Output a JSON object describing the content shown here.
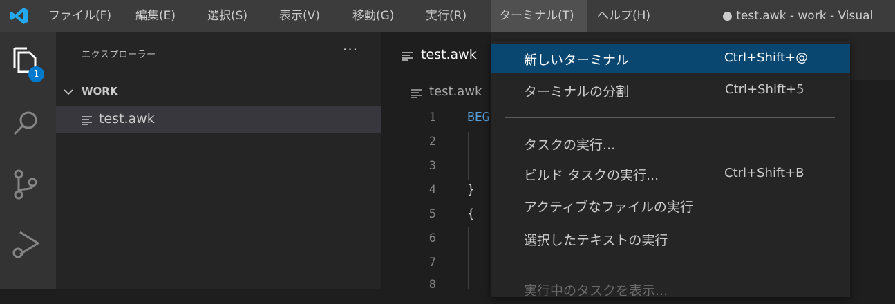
{
  "menubar": {
    "items": [
      {
        "label": "ファイル(F)"
      },
      {
        "label": "編集(E)"
      },
      {
        "label": "選択(S)"
      },
      {
        "label": "表示(V)"
      },
      {
        "label": "移動(G)"
      },
      {
        "label": "実行(R)"
      },
      {
        "label": "ターミナル(T)",
        "active": true
      },
      {
        "label": "ヘルプ(H)"
      }
    ],
    "window_title": "● test.awk - work - Visual"
  },
  "activitybar": {
    "explorer_badge": "1",
    "icons": [
      "files-icon",
      "search-icon",
      "source-control-icon",
      "run-debug-icon"
    ]
  },
  "sidebar": {
    "title": "エクスプローラー",
    "more": "···",
    "folder": "WORK",
    "file": "test.awk"
  },
  "editor": {
    "tab_label": "test.awk",
    "breadcrumb": "test.awk",
    "line_numbers": [
      "1",
      "2",
      "3",
      "4",
      "5",
      "6",
      "7",
      "8"
    ],
    "lines": [
      "BEG",
      "",
      "",
      "}",
      "{",
      "",
      "",
      ""
    ]
  },
  "terminal_menu": {
    "items": [
      {
        "label": "新しいターミナル",
        "shortcut": "Ctrl+Shift+@"
      },
      {
        "label": "ターミナルの分割",
        "shortcut": "Ctrl+Shift+5"
      },
      {
        "label": "タスクの実行...",
        "shortcut": ""
      },
      {
        "label": "ビルド タスクの実行...",
        "shortcut": "Ctrl+Shift+B"
      },
      {
        "label": "アクティブなファイルの実行",
        "shortcut": ""
      },
      {
        "label": "選択したテキストの実行",
        "shortcut": ""
      },
      {
        "label": "実行中のタスクを表示...",
        "shortcut": ""
      }
    ]
  },
  "colors": {
    "accent": "#007acc",
    "menu_selected": "#094771",
    "titlebar": "#3c3c3c"
  }
}
